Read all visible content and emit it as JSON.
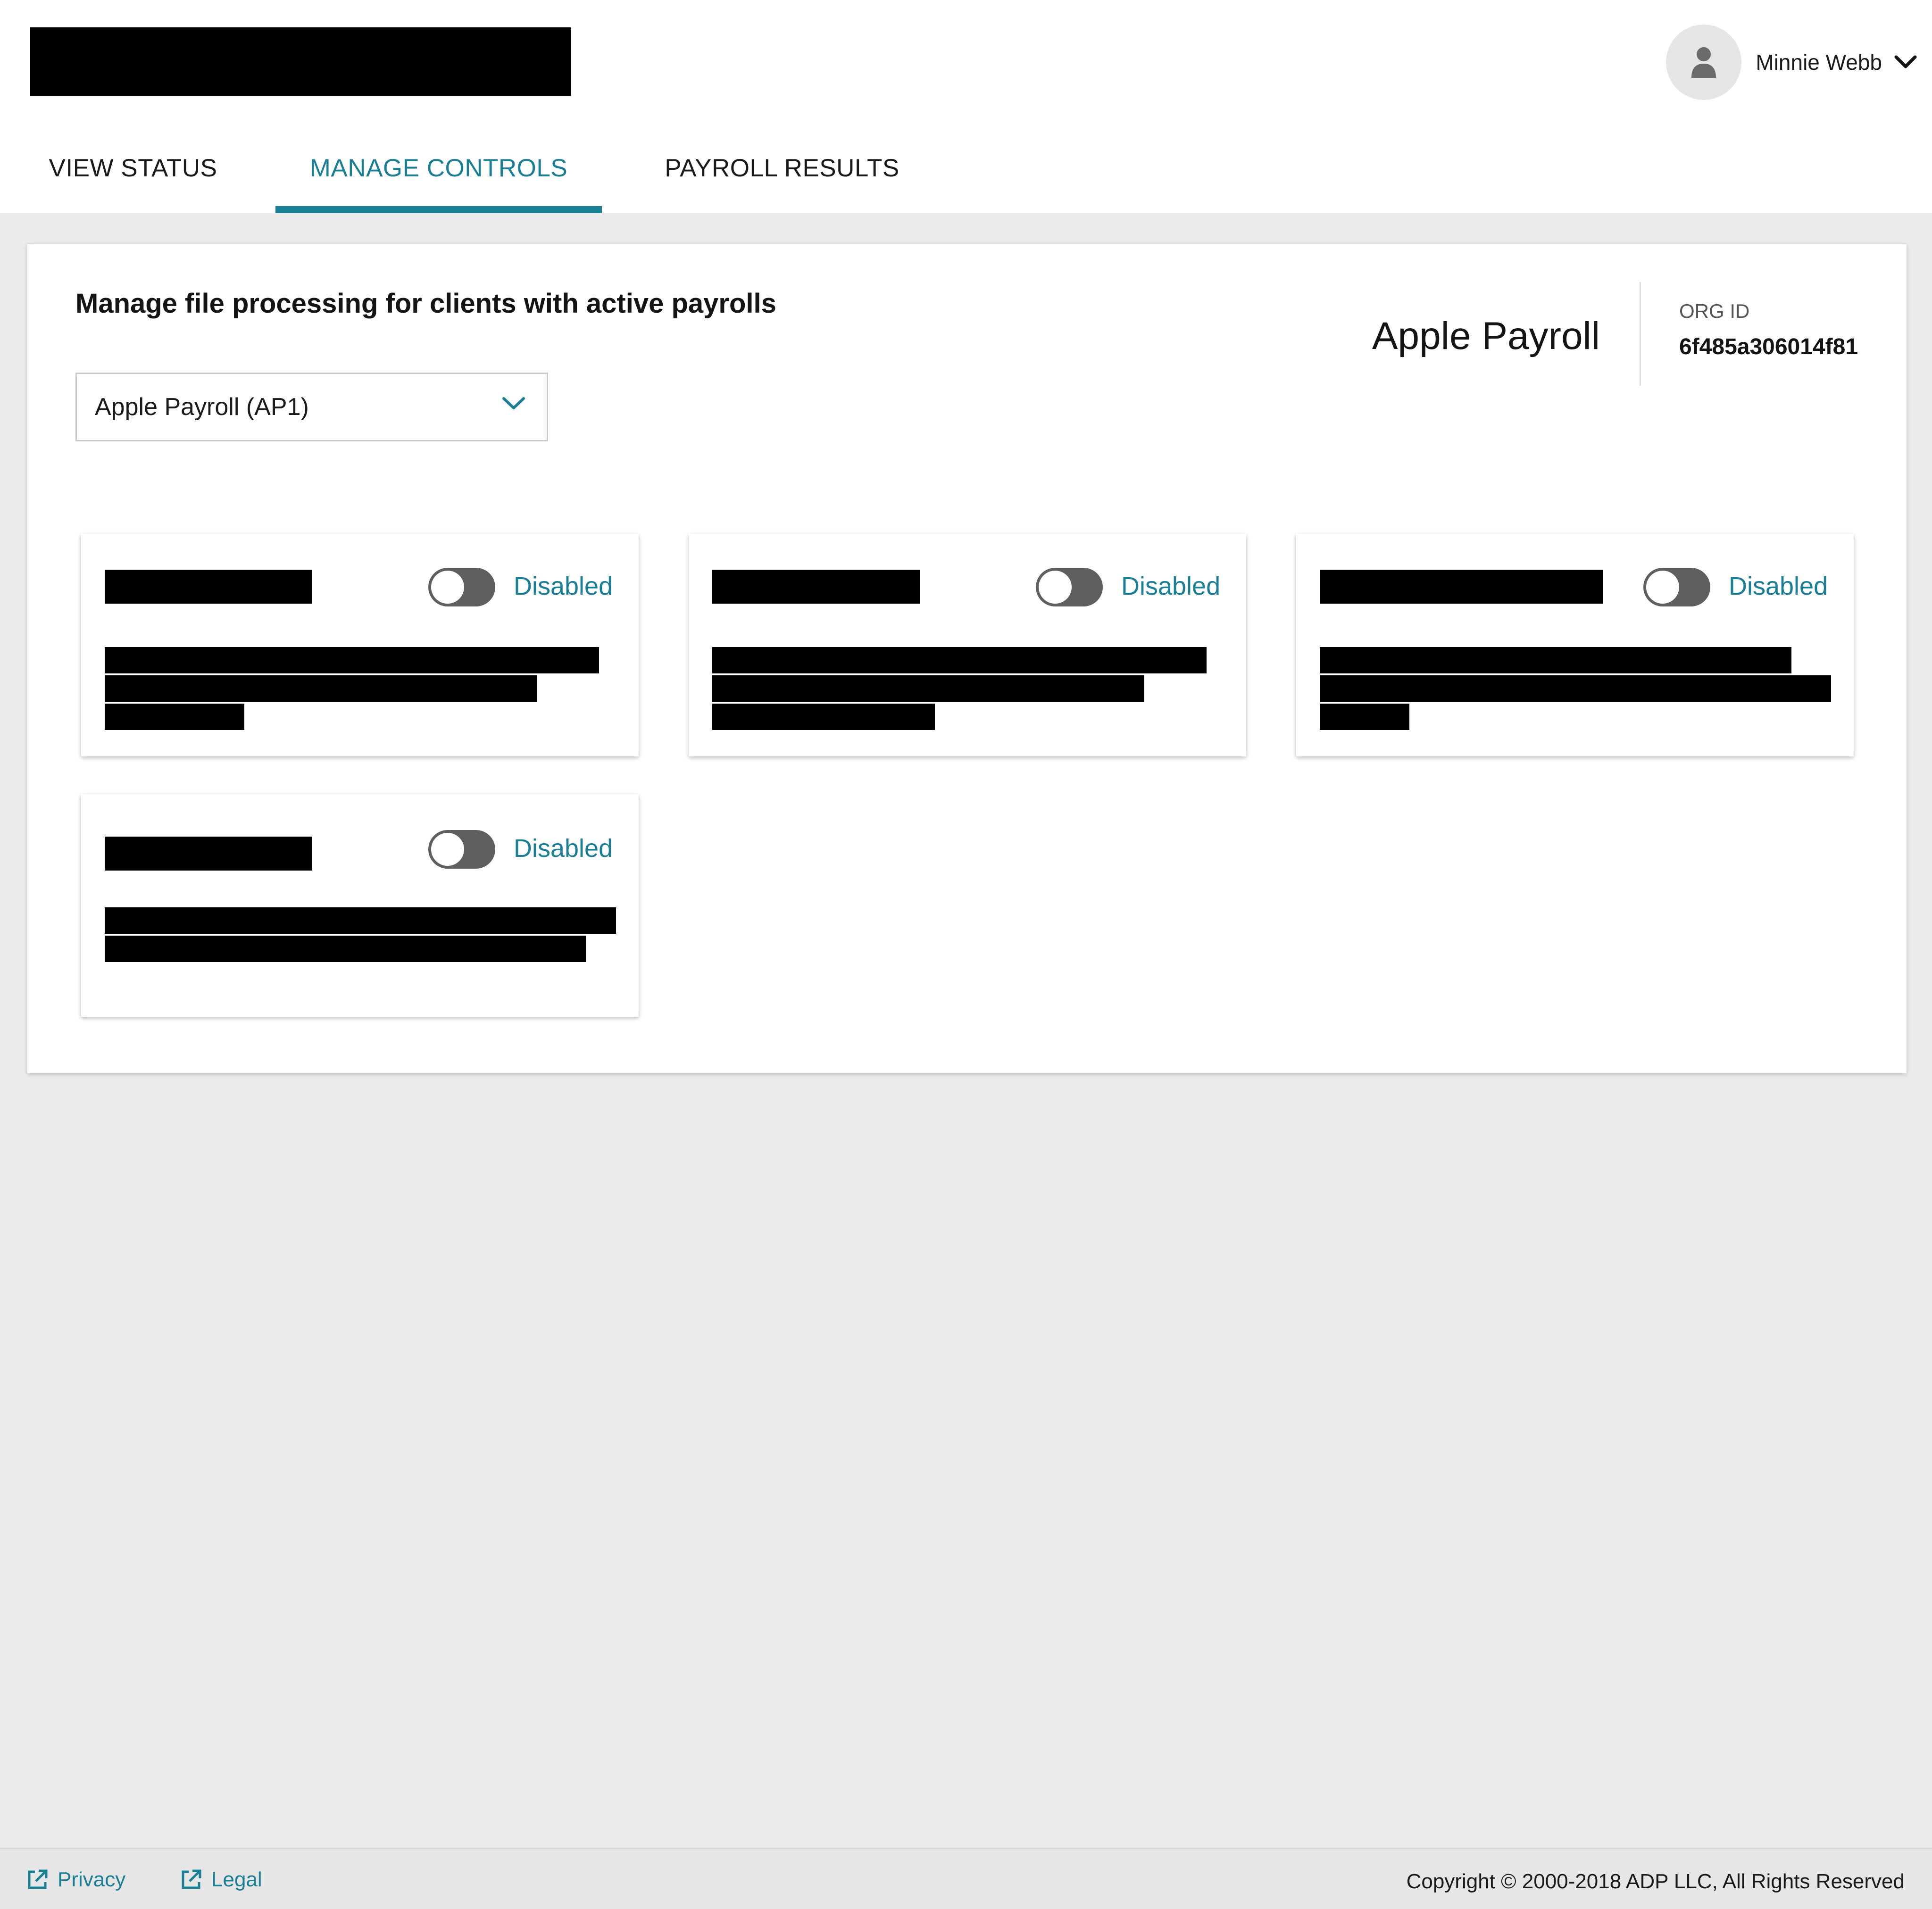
{
  "header": {
    "user_name": "Minnie Webb",
    "avatar_icon": "user-icon",
    "menu_icon": "chevron-down-icon"
  },
  "tabs": [
    {
      "label": "VIEW STATUS",
      "active": false
    },
    {
      "label": "MANAGE CONTROLS",
      "active": true
    },
    {
      "label": "PAYROLL RESULTS",
      "active": false
    }
  ],
  "panel": {
    "title": "Manage file processing for clients with active payrolls",
    "select_value": "Apple Payroll (AP1)",
    "client_name": "Apple Payroll",
    "org_label": "ORG ID",
    "org_value": "6f485a306014f81"
  },
  "cards": [
    {
      "status": "Disabled",
      "enabled": false
    },
    {
      "status": "Disabled",
      "enabled": false
    },
    {
      "status": "Disabled",
      "enabled": false
    },
    {
      "status": "Disabled",
      "enabled": false
    }
  ],
  "footer": {
    "privacy": "Privacy",
    "legal": "Legal",
    "copyright": "Copyright © 2000-2018 ADP LLC, All Rights Reserved"
  },
  "colors": {
    "accent": "#1a7f95",
    "toggle_off": "#5f5f5f",
    "background": "#ebebeb"
  }
}
